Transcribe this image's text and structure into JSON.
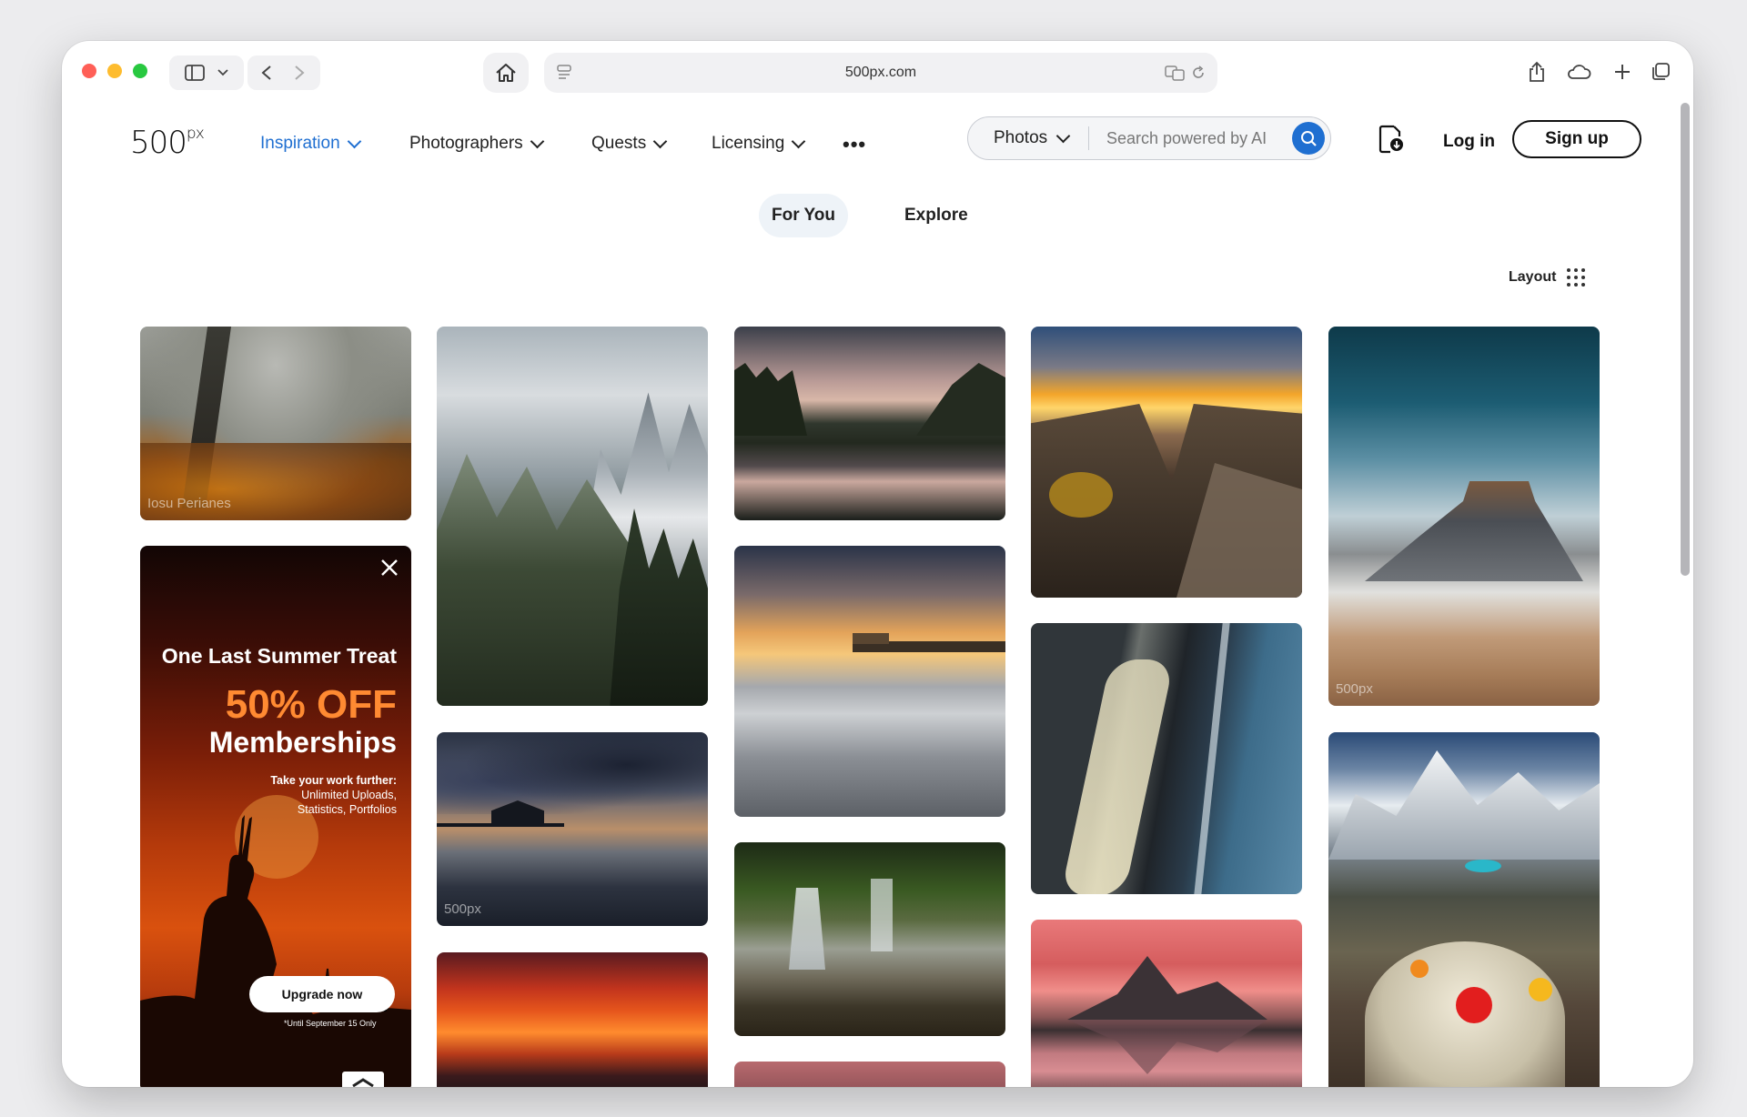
{
  "browser": {
    "url": "500px.com",
    "traffic_colors": [
      "#ff5f57",
      "#febc2e",
      "#28c840"
    ]
  },
  "site": {
    "logo_main": "500",
    "logo_sup": "px",
    "nav": [
      {
        "label": "Inspiration",
        "active": true
      },
      {
        "label": "Photographers",
        "active": false
      },
      {
        "label": "Quests",
        "active": false
      },
      {
        "label": "Licensing",
        "active": false
      }
    ],
    "more_label": "•••",
    "search": {
      "type": "Photos",
      "placeholder": "Search powered by AI"
    },
    "login_label": "Log in",
    "signup_label": "Sign up",
    "accent": "#1f6fd1"
  },
  "tabs": [
    {
      "label": "For You",
      "active": true
    },
    {
      "label": "Explore",
      "active": false
    }
  ],
  "layout_label": "Layout",
  "photo_watermarks": {
    "misty_forest": "Iosu Perianes",
    "generic": "500px"
  },
  "ad": {
    "headline": "One Last Summer Treat",
    "discount": "50% OFF",
    "product": "Memberships",
    "sub_title": "Take your work further:",
    "sub_lines": [
      "Unlimited Uploads,",
      "Statistics, Portfolios"
    ],
    "button": "Upgrade now",
    "fineprint": "*Until September 15 Only"
  }
}
